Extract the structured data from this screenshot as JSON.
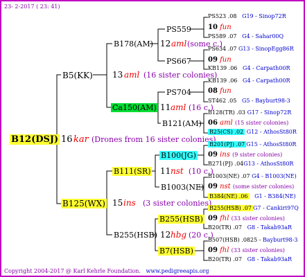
{
  "header": {
    "date": "23- 2-2017 ( 23: 41)"
  },
  "footer": {
    "copyright": "Copyright 2004-2017 @ Karl Kehrle Foundation.",
    "site": "www.pedigreeapis.org"
  },
  "root": {
    "label": "B12(DSJ)",
    "year": "16",
    "name": "kar",
    "note": "(Drones from 16 sister colonies)"
  },
  "gen1": {
    "top": {
      "label": "B5(KK)",
      "year": "13",
      "name": "aml",
      "note": "(16 sister colonies)"
    },
    "bottom": {
      "label": "B125(WX)",
      "year": "15",
      "name": "ins",
      "note": "(3 sister colonies)"
    }
  },
  "gen2": {
    "a": {
      "label": "B178(AM)",
      "year": "12",
      "name": "aml",
      "note": "(some c.)"
    },
    "b": {
      "label": "Ca150(AM)",
      "year": "11",
      "name": "aml",
      "note": "(16 c.)"
    },
    "c": {
      "label": "B111(SR)",
      "year": "11",
      "name": "nst",
      "note": "(10 c.)"
    },
    "d": {
      "label": "B255(HSB)",
      "year": "12",
      "name": "hbg",
      "note": "(20 c.)"
    }
  },
  "gen3": {
    "a": "PS559",
    "b": "PS667",
    "c": "PS704",
    "d": "B121(AM)",
    "e": "B100(JG)",
    "f": "B1003(NE)",
    "g": "B255(HSB)",
    "h": "B7(HSB)"
  },
  "gen4": [
    {
      "label": "PS523",
      "year": ".08",
      "extra": "G19 - Sinop72R"
    },
    {
      "label": "10",
      "name": "fun"
    },
    {
      "label": "PS589",
      "year": ".07",
      "extra": "G4 - Sahar00Q"
    },
    {
      "label": "PS634",
      "year": ".07",
      "extra": "G13 - SinopEgg86R"
    },
    {
      "label": "09",
      "name": "fun"
    },
    {
      "label": "KB139",
      "year": ".06",
      "extra": "G4 - Carpath00R"
    },
    {
      "label": "KB139",
      "year": ".06",
      "extra": "G4 - Carpath00R"
    },
    {
      "label": "08",
      "name": "fun"
    },
    {
      "label": "ST462",
      "year": ".05",
      "extra": "G5 - Bayburt98-3"
    },
    {
      "label": "B128(TR)",
      "year": ".03",
      "extra": "G17 - Sinop72R"
    },
    {
      "label": "06",
      "name": "aml",
      "note": "(15 sister colonies)"
    },
    {
      "label": "B25(CS)",
      "year": ".02",
      "extra": "G12 - AthosSt80R"
    },
    {
      "label": "B201(PJ)",
      "year": ".07",
      "extra": "G15 - AthosSt80R"
    },
    {
      "label": "09",
      "name": "ins",
      "note": "(9 sister colonies)"
    },
    {
      "label": "B271(PJ)",
      "year": ".04",
      "extra": "G13 - AthosSt80R"
    },
    {
      "label": "B1003(NE)",
      "year": ".07",
      "extra": "G4 - B1003(NE)"
    },
    {
      "label": "09",
      "name": "nst",
      "note": "(some sister colonies)"
    },
    {
      "label": "B384(NE)",
      "year": ".06",
      "extra": "G1 - B384(NE)"
    },
    {
      "label": "B255(HSB)",
      "year": ".07",
      "extra": "G7 - Cankiri97Q"
    },
    {
      "label": "09",
      "name": "fhl",
      "note": "(33 sister colonies)"
    },
    {
      "label": "B20(TR)",
      "year": ".07",
      "extra": "G8 - Takab93aR"
    },
    {
      "label": "B507(HSB)",
      "year": ".0825",
      "extra": "Bayburt98-3"
    },
    {
      "label": "09",
      "name": "fhl",
      "note": "(33 sister colonies)"
    },
    {
      "label": "B20(TR)",
      "year": ".07",
      "extra": "G8 - Takab93aR"
    }
  ],
  "colors": {
    "border": "#c000c0",
    "yellow": "#ffff33",
    "green": "#00dd33",
    "cyan": "#33ffff",
    "red": "#ee0000",
    "blue": "#0000cc",
    "purple": "#8800aa"
  }
}
